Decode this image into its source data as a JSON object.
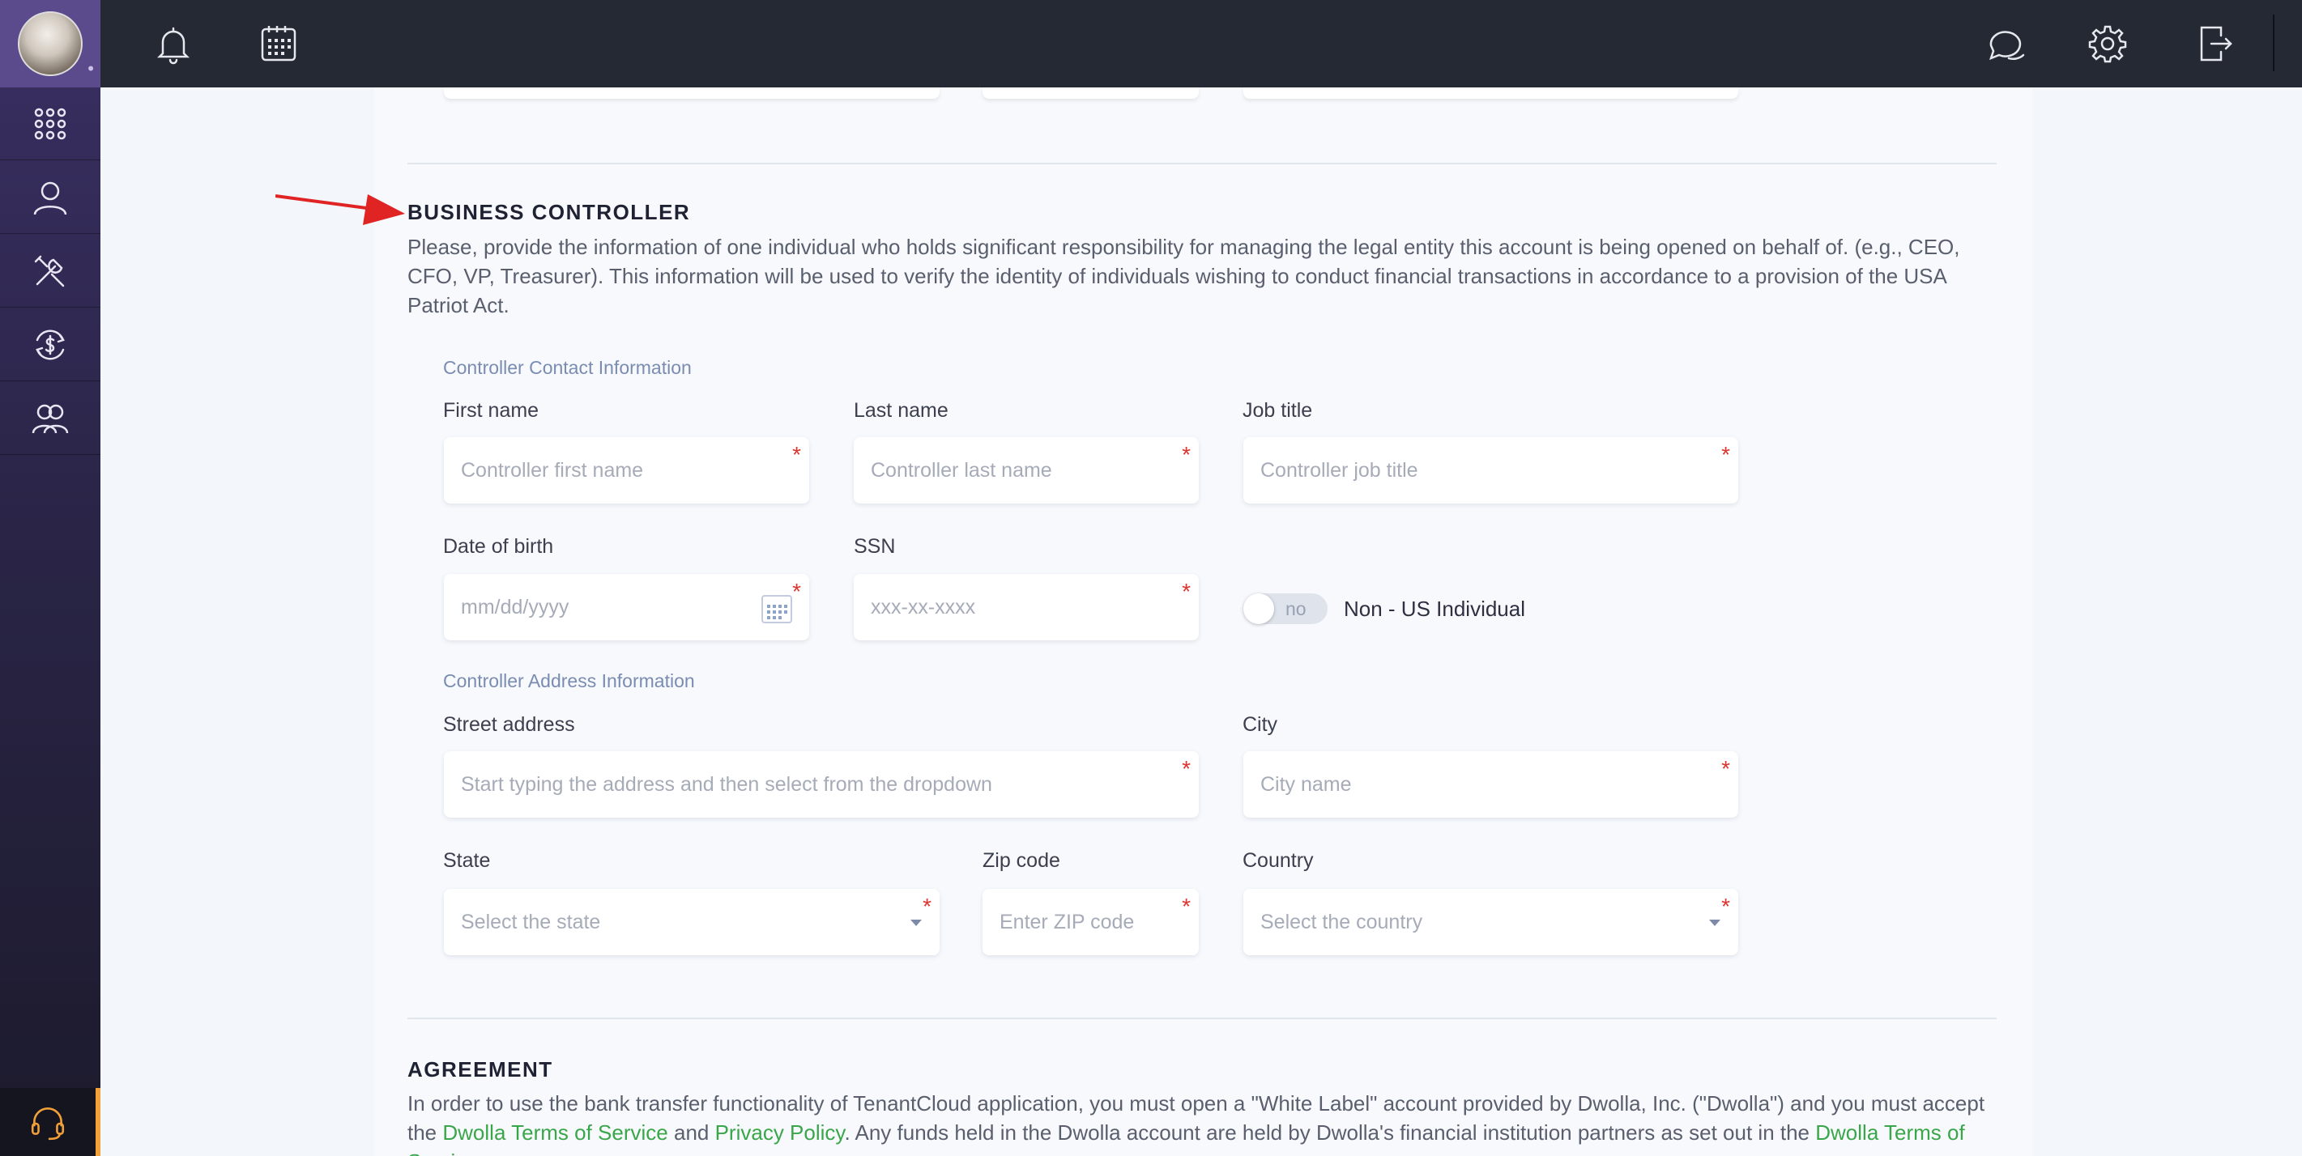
{
  "sidebar": {
    "items": [
      "apps-icon",
      "user-icon",
      "tools-icon",
      "payments-icon",
      "team-icon"
    ],
    "support_icon": "headset-icon"
  },
  "topbar": {
    "icons": [
      "bell-icon",
      "calendar-icon",
      "chat-icon",
      "gear-icon",
      "logout-icon"
    ]
  },
  "business_controller": {
    "title": "BUSINESS CONTROLLER",
    "description": "Please, provide the information of one individual who holds significant responsibility for managing the legal entity this account is being opened on behalf of. (e.g., CEO, CFO, VP, Treasurer). This information will be used to verify the identity of individuals wishing to conduct financial transactions in accordance to a provision of the USA Patriot Act.",
    "contact_heading": "Controller Contact Information",
    "address_heading": "Controller Address Information",
    "fields": {
      "first_name": {
        "label": "First name",
        "placeholder": "Controller first name"
      },
      "last_name": {
        "label": "Last name",
        "placeholder": "Controller last name"
      },
      "job_title": {
        "label": "Job title",
        "placeholder": "Controller job title"
      },
      "dob": {
        "label": "Date of birth",
        "placeholder": "mm/dd/yyyy"
      },
      "ssn": {
        "label": "SSN",
        "placeholder": "xxx-xx-xxxx"
      },
      "street": {
        "label": "Street address",
        "placeholder": "Start typing the address and then select from the dropdown"
      },
      "city": {
        "label": "City",
        "placeholder": "City name"
      },
      "state": {
        "label": "State",
        "placeholder": "Select the state"
      },
      "zip": {
        "label": "Zip code",
        "placeholder": "Enter ZIP code"
      },
      "country": {
        "label": "Country",
        "placeholder": "Select the country"
      }
    },
    "required_mark": "*",
    "non_us_toggle": {
      "state_text": "no",
      "label": "Non - US Individual"
    }
  },
  "agreement": {
    "title": "AGREEMENT",
    "text_1": "In order to use the bank transfer functionality of TenantCloud application, you must open a \"White Label\" account provided by Dwolla, Inc. (\"Dwolla\") and you must accept the ",
    "link_terms": "Dwolla Terms of Service",
    "text_2": " and ",
    "link_privacy": "Privacy Policy",
    "text_3": ". Any funds held in the Dwolla account are held by Dwolla's financial institution partners as set out in the ",
    "link_terms_2": "Dwolla Terms of Service"
  },
  "colors": {
    "sidebar_top": "#3a2f63",
    "topbar": "#252933",
    "link": "#3aa64a",
    "required": "#e0342f",
    "arrow": "#e02323",
    "subheading": "#7a8cb2"
  }
}
